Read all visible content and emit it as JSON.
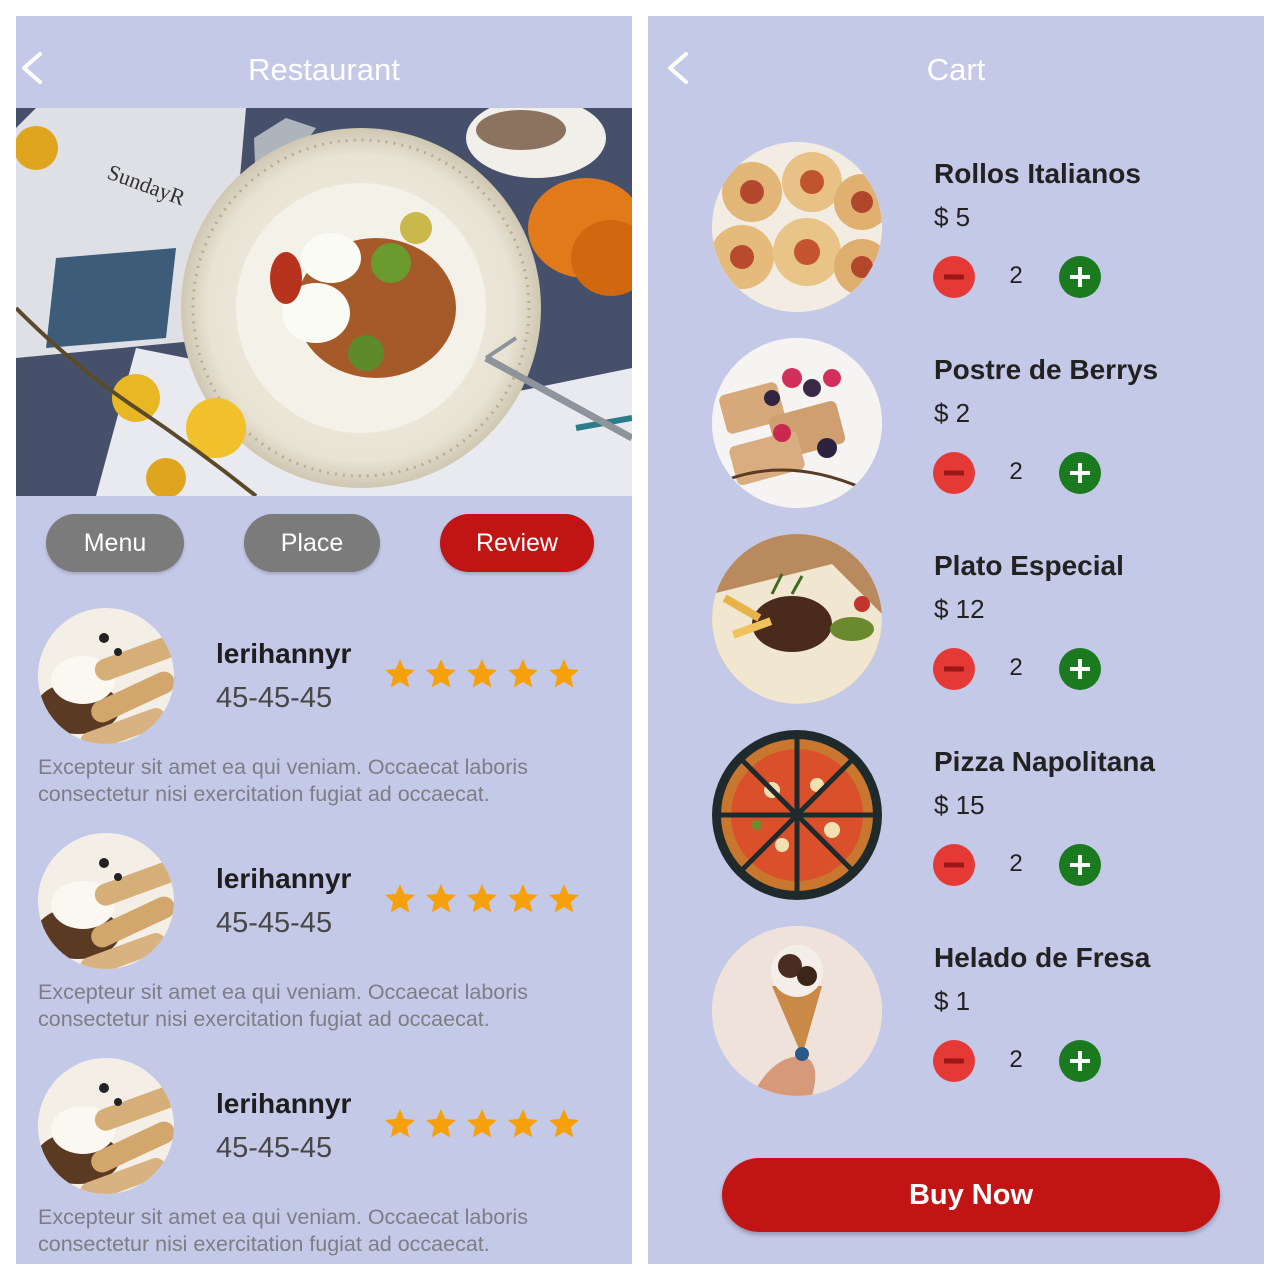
{
  "colors": {
    "screen_bg": "#c5c9e8",
    "accent_red": "#c11515",
    "tab_inactive": "#7b7b7b",
    "star": "#f6a10b",
    "minus": "#e53935",
    "plus": "#1b7a1f"
  },
  "restaurant": {
    "title": "Restaurant",
    "back_icon": "chevron-left-icon",
    "tabs": [
      {
        "label": "Menu",
        "active": false
      },
      {
        "label": "Place",
        "active": false
      },
      {
        "label": "Review",
        "active": true
      }
    ],
    "reviews": [
      {
        "name": "lerihannyr",
        "code": "45-45-45",
        "rating": 5,
        "text": "Excepteur sit amet ea qui veniam. Occaecat laboris consectetur nisi exercitation fugiat ad occaecat."
      },
      {
        "name": "lerihannyr",
        "code": "45-45-45",
        "rating": 5,
        "text": "Excepteur sit amet ea qui veniam. Occaecat laboris consectetur nisi exercitation fugiat ad occaecat."
      },
      {
        "name": "lerihannyr",
        "code": "45-45-45",
        "rating": 5,
        "text": "Excepteur sit amet ea qui veniam. Occaecat laboris consectetur nisi exercitation fugiat ad occaecat."
      }
    ]
  },
  "cart": {
    "title": "Cart",
    "back_icon": "chevron-left-icon",
    "items": [
      {
        "name": "Rollos Italianos",
        "price": "$ 5",
        "qty": "2"
      },
      {
        "name": "Postre de Berrys",
        "price": "$ 2",
        "qty": "2"
      },
      {
        "name": "Plato Especial",
        "price": "$ 12",
        "qty": "2"
      },
      {
        "name": "Pizza Napolitana",
        "price": "$ 15",
        "qty": "2"
      },
      {
        "name": "Helado de Fresa",
        "price": "$ 1",
        "qty": "2"
      }
    ],
    "buy_label": "Buy Now"
  }
}
